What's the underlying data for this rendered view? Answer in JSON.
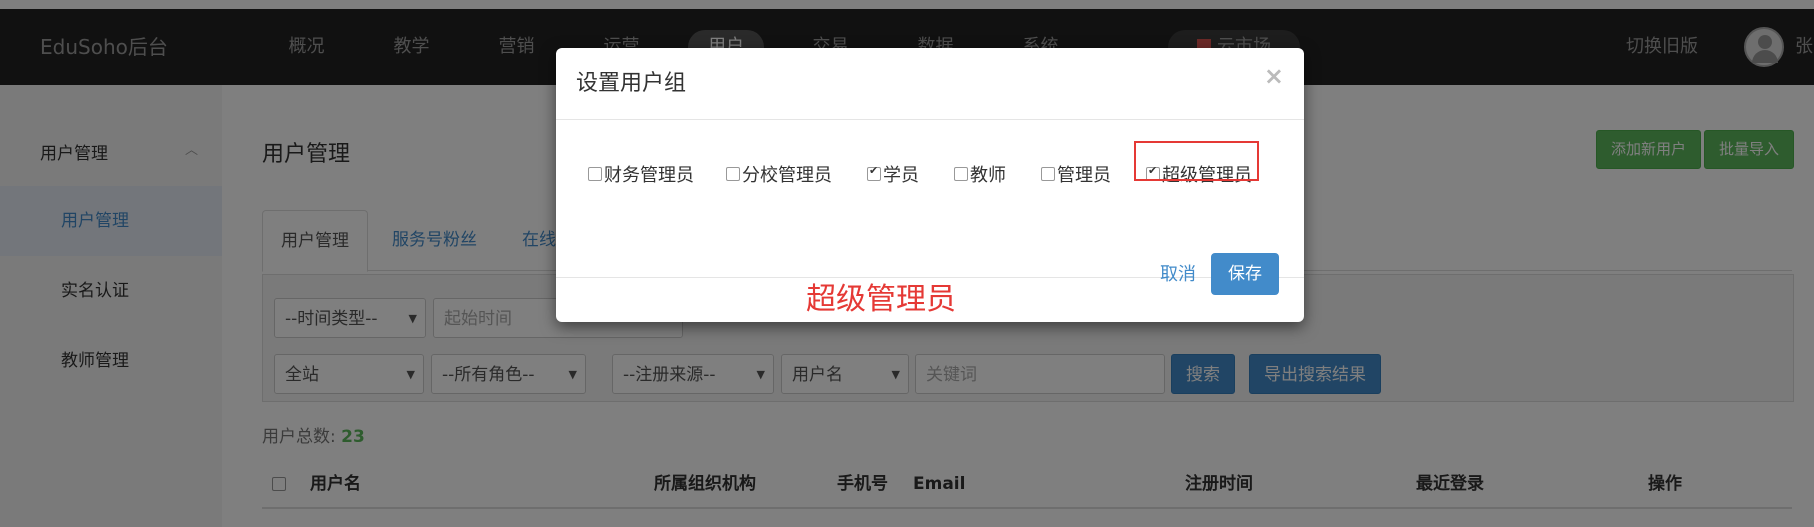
{
  "topbar": {
    "brand": "EduSoho后台",
    "nav": [
      "概况",
      "教学",
      "营销",
      "运营",
      "用户",
      "交易",
      "数据",
      "系统"
    ],
    "active_nav": "用户",
    "store": "云市场",
    "switch_label": "切换旧版",
    "username": "张"
  },
  "sidebar": {
    "group": "用户管理",
    "items": [
      "用户管理",
      "实名认证",
      "教师管理"
    ]
  },
  "main": {
    "title": "用户管理",
    "add_user": "添加新用户",
    "batch_import": "批量导入",
    "tabs": [
      "用户管理",
      "服务号粉丝",
      "在线"
    ],
    "filters": {
      "time_type": "--时间类型--",
      "start_time": "起始时间",
      "site": "全站",
      "role": "--所有角色--",
      "source": "--注册来源--",
      "field": "用户名",
      "keyword_placeholder": "关键词",
      "search": "搜索",
      "export": "导出搜索结果"
    },
    "total_label": "用户总数:",
    "total_value": "23",
    "columns": [
      "用户名",
      "所属组织机构",
      "手机号",
      "Email",
      "注册时间",
      "最近登录",
      "操作"
    ]
  },
  "modal": {
    "title": "设置用户组",
    "close": "×",
    "roles": [
      {
        "label": "财务管理员",
        "checked": false
      },
      {
        "label": "分校管理员",
        "checked": false
      },
      {
        "label": "学员",
        "checked": true
      },
      {
        "label": "教师",
        "checked": false
      },
      {
        "label": "管理员",
        "checked": false
      },
      {
        "label": "超级管理员",
        "checked": true
      }
    ],
    "annotation": "超级管理员",
    "cancel": "取消",
    "save": "保存"
  },
  "colors": {
    "topbar": "#222222",
    "primary": "#428bca",
    "success": "#5cb85c",
    "highlight": "#e53935"
  }
}
